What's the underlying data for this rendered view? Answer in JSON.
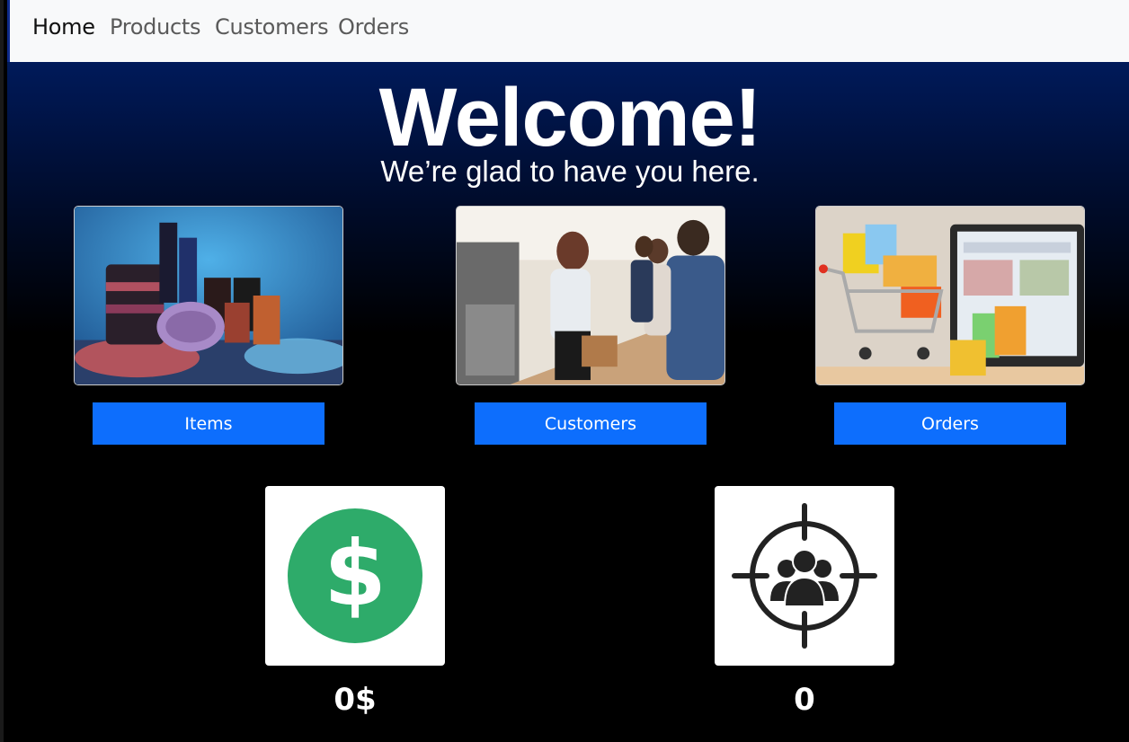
{
  "nav": {
    "items": [
      {
        "label": "Home",
        "active": true
      },
      {
        "label": "Products",
        "active": false
      },
      {
        "label": "Customers",
        "active": false
      },
      {
        "label": "Orders",
        "active": false
      }
    ]
  },
  "hero": {
    "title": "Welcome!",
    "subtitle": "We’re glad to have you here."
  },
  "cards": [
    {
      "image": "cosmetics-photo",
      "button_label": "Items"
    },
    {
      "image": "cafe-customers-photo",
      "button_label": "Customers"
    },
    {
      "image": "shopping-cart-photo",
      "button_label": "Orders"
    }
  ],
  "stats": {
    "revenue": {
      "icon": "dollar-icon",
      "value": "0$",
      "color": "#2eab6a"
    },
    "customers": {
      "icon": "target-audience-icon",
      "value": "0",
      "color": "#222222"
    }
  },
  "colors": {
    "button": "#0d6efd",
    "navbar": "#f8f9fa",
    "hero_top": "#001a5a"
  }
}
